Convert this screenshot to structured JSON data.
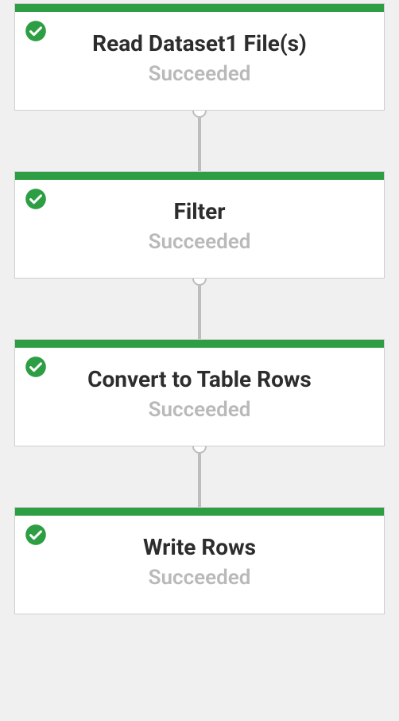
{
  "colors": {
    "success": "#2e9e44",
    "border": "#cfcfcf",
    "connector": "#bdbdbd",
    "status_text": "#b9b9b9"
  },
  "pipeline": {
    "nodes": [
      {
        "title": "Read Dataset1 File(s)",
        "status": "Succeeded",
        "state_icon": "check-circle"
      },
      {
        "title": "Filter",
        "status": "Succeeded",
        "state_icon": "check-circle"
      },
      {
        "title": "Convert to Table Rows",
        "status": "Succeeded",
        "state_icon": "check-circle"
      },
      {
        "title": "Write Rows",
        "status": "Succeeded",
        "state_icon": "check-circle"
      }
    ]
  }
}
